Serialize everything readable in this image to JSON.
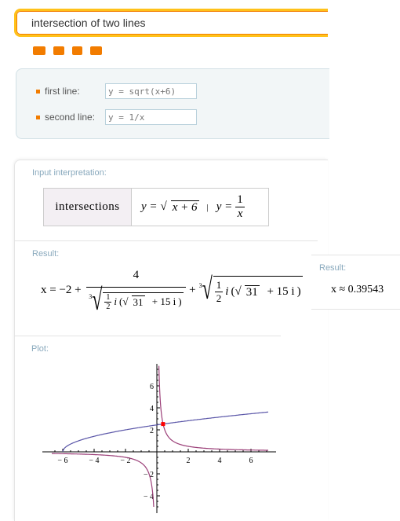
{
  "search": {
    "query": "intersection of two lines"
  },
  "toolbar_icons": [
    "keyboard-icon",
    "camera-icon",
    "list-icon",
    "upload-folder-icon"
  ],
  "form": {
    "first_label": "first line:",
    "first_value": "y = sqrt(x+6)",
    "second_label": "second line:",
    "second_value": "y = 1/x"
  },
  "input_interpretation": {
    "label": "Input interpretation:",
    "left": "intersections",
    "eq1_lhs": "y =",
    "eq1_rad": "x + 6",
    "sep": "|",
    "eq2_lhs": "y =",
    "eq2_num": "1",
    "eq2_den": "x"
  },
  "result": {
    "label": "Result:",
    "x_eq": "x = −2 +",
    "num": "4",
    "half_num": "1",
    "half_den": "2",
    "i": "i",
    "sqrt31": "31",
    "plus15i": "+ 15 i",
    "cbrt_index": "3",
    "plus": "+"
  },
  "popup": {
    "label": "Result:",
    "value": "x ≈ 0.39543"
  },
  "plot": {
    "label": "Plot:"
  },
  "chart_data": {
    "type": "line",
    "functions": [
      "sqrt(x+6)",
      "1/x"
    ],
    "intersection": {
      "x": 0.39543,
      "y": 2.5288
    },
    "xlim": [
      -6.7,
      7.1
    ],
    "ylim": [
      -5,
      7.9
    ],
    "xticks": [
      "-6",
      "-4",
      "-2",
      "2",
      "4",
      "6"
    ],
    "yticks": [
      "6",
      "4",
      "2",
      "-2",
      "-4"
    ],
    "colors": {
      "sqrt": "#5a56a8",
      "recip": "#9b3f78",
      "point": "#ff0000"
    }
  }
}
